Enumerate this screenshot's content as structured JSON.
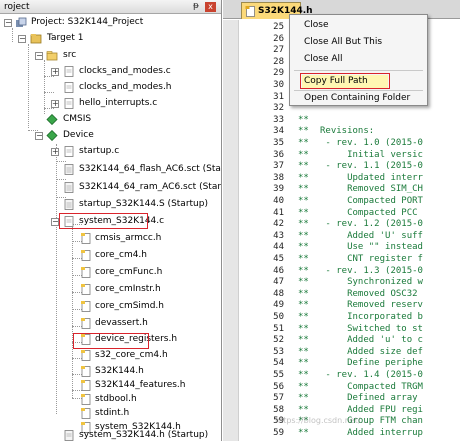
{
  "panel": {
    "title": "roject",
    "pin_glyph": "ᵽ",
    "close_glyph": "x"
  },
  "tree": [
    {
      "label": "Project: S32K144_Project",
      "icon": "project-icon"
    },
    {
      "label": "Target 1",
      "icon": "target-icon"
    },
    {
      "label": "src",
      "icon": "folder-icon"
    },
    {
      "label": "clocks_and_modes.c",
      "icon": "c-file-icon"
    },
    {
      "label": "clocks_and_modes.h",
      "icon": "h-file-icon"
    },
    {
      "label": "hello_interrupts.c",
      "icon": "c-file-icon"
    },
    {
      "label": "CMSIS",
      "icon": "component-icon"
    },
    {
      "label": "Device",
      "icon": "component-icon"
    },
    {
      "label": "startup.c",
      "icon": "c-file-icon"
    },
    {
      "label": "S32K144_64_flash_AC6.sct (Startup)",
      "icon": "config-file-icon"
    },
    {
      "label": "S32K144_64_ram_AC6.sct (Startup)",
      "icon": "config-file-icon"
    },
    {
      "label": "startup_S32K144.S (Startup)",
      "icon": "config-file-icon"
    },
    {
      "label": "system_S32K144.c",
      "icon": "c-file-icon"
    },
    {
      "label": "cmsis_armcc.h",
      "icon": "h-file-icon"
    },
    {
      "label": "core_cm4.h",
      "icon": "h-file-icon"
    },
    {
      "label": "core_cmFunc.h",
      "icon": "h-file-icon"
    },
    {
      "label": "core_cmInstr.h",
      "icon": "h-file-icon"
    },
    {
      "label": "core_cmSimd.h",
      "icon": "h-file-icon"
    },
    {
      "label": "devassert.h",
      "icon": "h-file-icon"
    },
    {
      "label": "device_registers.h",
      "icon": "h-file-icon"
    },
    {
      "label": "s32_core_cm4.h",
      "icon": "h-file-icon"
    },
    {
      "label": "S32K144.h",
      "icon": "h-file-icon"
    },
    {
      "label": "S32K144_features.h",
      "icon": "h-file-icon"
    },
    {
      "label": "stdbool.h",
      "icon": "h-file-icon"
    },
    {
      "label": "stdint.h",
      "icon": "h-file-icon"
    },
    {
      "label": "system_S32K144.h",
      "icon": "h-file-icon"
    },
    {
      "label": "system_S32K144.h (Startup)",
      "icon": "config-file-icon"
    }
  ],
  "editor": {
    "tab_label": "S32K144.h",
    "lines": [
      {
        "n": "25",
        "star": "",
        "text": ""
      },
      {
        "n": "26",
        "star": "",
        "text": "                 AND"
      },
      {
        "n": "27",
        "star": "",
        "text": "                 Y,"
      },
      {
        "n": "28",
        "star": "",
        "text": "                 OF"
      },
      {
        "n": "29",
        "star": "",
        "text": "                 OF"
      },
      {
        "n": "30",
        "star": "",
        "text": ""
      },
      {
        "n": "31",
        "star": "",
        "text": ""
      },
      {
        "n": "32",
        "star": "",
        "text": ""
      },
      {
        "n": "33",
        "star": "**",
        "text": ""
      },
      {
        "n": "34",
        "star": "**",
        "text": "Revisions:"
      },
      {
        "n": "35",
        "star": "**",
        "text": " - rev. 1.0 (2015-0"
      },
      {
        "n": "36",
        "star": "**",
        "text": "     Initial versic"
      },
      {
        "n": "37",
        "star": "**",
        "text": " - rev. 1.1 (2015-0"
      },
      {
        "n": "38",
        "star": "**",
        "text": "     Updated interr"
      },
      {
        "n": "39",
        "star": "**",
        "text": "     Removed SIM_CH"
      },
      {
        "n": "40",
        "star": "**",
        "text": "     Compacted PORT"
      },
      {
        "n": "41",
        "star": "**",
        "text": "     Compacted PCC"
      },
      {
        "n": "42",
        "star": "**",
        "text": " - rev. 1.2 (2015-0"
      },
      {
        "n": "43",
        "star": "**",
        "text": "     Added 'U' suff"
      },
      {
        "n": "44",
        "star": "**",
        "text": "     Use \"\" instead"
      },
      {
        "n": "45",
        "star": "**",
        "text": "     CNT register f"
      },
      {
        "n": "46",
        "star": "**",
        "text": " - rev. 1.3 (2015-0"
      },
      {
        "n": "47",
        "star": "**",
        "text": "     Synchronized w"
      },
      {
        "n": "48",
        "star": "**",
        "text": "     Removed OSC32"
      },
      {
        "n": "49",
        "star": "**",
        "text": "     Removed reserv"
      },
      {
        "n": "50",
        "star": "**",
        "text": "     Incorporated b"
      },
      {
        "n": "51",
        "star": "**",
        "text": "     Switched to st"
      },
      {
        "n": "52",
        "star": "**",
        "text": "     Added 'u' to c"
      },
      {
        "n": "53",
        "star": "**",
        "text": "     Added size def"
      },
      {
        "n": "54",
        "star": "**",
        "text": "     Define periphe"
      },
      {
        "n": "55",
        "star": "**",
        "text": " - rev. 1.4 (2015-0"
      },
      {
        "n": "56",
        "star": "**",
        "text": "     Compacted TRGM"
      },
      {
        "n": "57",
        "star": "**",
        "text": "     Defined array"
      },
      {
        "n": "58",
        "star": "**",
        "text": "     Added FPU regi"
      },
      {
        "n": "59",
        "star": "**",
        "text": "     Group FTM chan"
      },
      {
        "n": "59",
        "star": "**",
        "text": "     Added interrup"
      }
    ]
  },
  "context_menu": {
    "close": "Close",
    "close_all_but_this": "Close All But This",
    "close_all": "Close All",
    "copy_full_path": "Copy Full Path",
    "open_containing_folder": "Open Containing Folder"
  },
  "watermark": "https://blog.csdn.net/..."
}
